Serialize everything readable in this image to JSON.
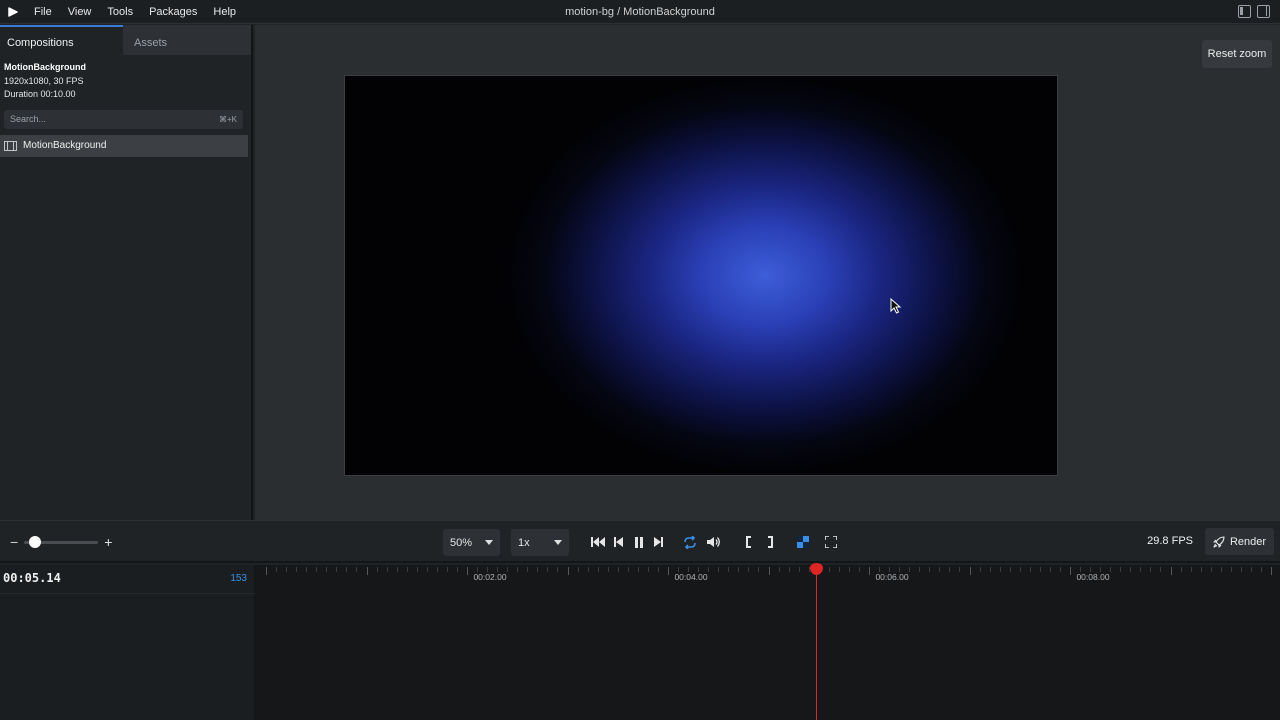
{
  "menubar": {
    "items": [
      "File",
      "View",
      "Tools",
      "Packages",
      "Help"
    ],
    "window_title": "motion-bg / MotionBackground"
  },
  "sidebar": {
    "tabs": [
      {
        "label": "Compositions"
      },
      {
        "label": "Assets"
      }
    ],
    "composition": {
      "name": "MotionBackground",
      "resolution_fps": "1920x1080, 30 FPS",
      "duration": "Duration 00:10.00"
    },
    "search": {
      "placeholder": "Search...",
      "shortcut": "⌘+K"
    },
    "items": [
      {
        "label": "MotionBackground"
      }
    ]
  },
  "preview": {
    "reset_zoom_label": "Reset zoom"
  },
  "controls": {
    "zoom_minus": "−",
    "zoom_plus": "+",
    "zoom_slider_value": 0.08,
    "zoom_value": "50%",
    "speed_value": "1x",
    "fps": "29.8 FPS",
    "render_label": "Render"
  },
  "timeline": {
    "timecode": "00:05.14",
    "frame": "153",
    "labels": [
      "00:02.00",
      "00:04.00",
      "00:06.00",
      "00:08.00"
    ],
    "playhead_time": "00:05.14"
  },
  "colors": {
    "accent": "#3a8ee6",
    "playhead": "#e02424"
  }
}
